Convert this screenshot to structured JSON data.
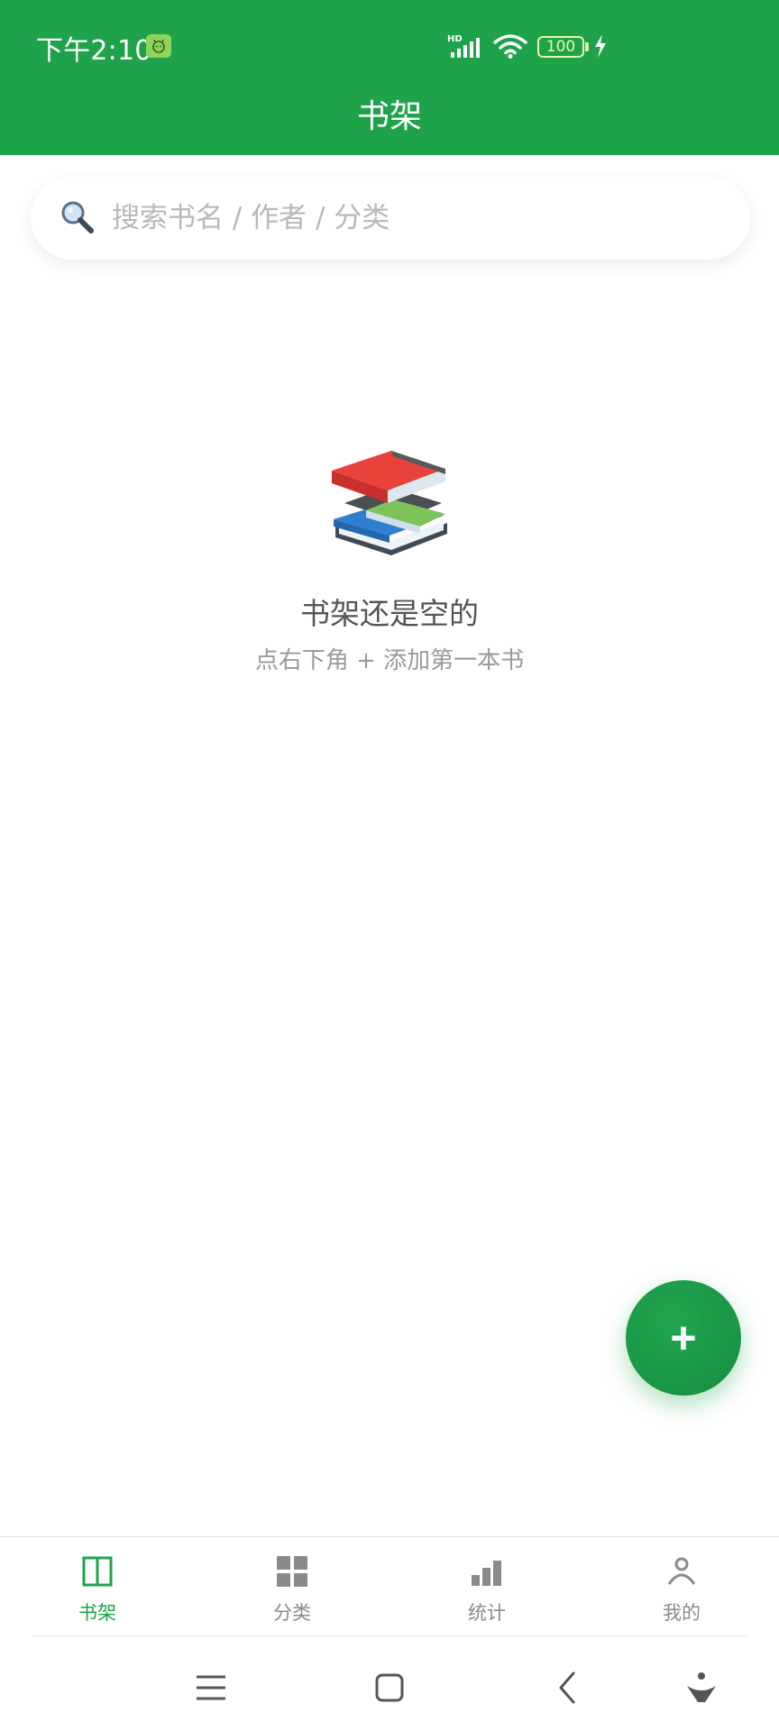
{
  "status_bar": {
    "time": "下午2:10",
    "network_label": "HD",
    "battery_level": "100"
  },
  "header": {
    "title": "书架"
  },
  "search": {
    "placeholder": "搜索书名 / 作者 / 分类"
  },
  "empty_state": {
    "title": "书架还是空的",
    "subtitle": "点右下角 + 添加第一本书"
  },
  "fab": {
    "label": "+"
  },
  "bottom_nav": {
    "items": [
      {
        "label": "书架",
        "icon": "book-icon",
        "active": true
      },
      {
        "label": "分类",
        "icon": "grid-icon",
        "active": false
      },
      {
        "label": "统计",
        "icon": "bar-chart-icon",
        "active": false
      },
      {
        "label": "我的",
        "icon": "person-icon",
        "active": false
      }
    ]
  },
  "system_nav": {
    "icons": [
      "menu-icon",
      "home-icon",
      "back-icon",
      "assistant-icon"
    ]
  },
  "colors": {
    "accent": "#1ea34a",
    "inactive": "#8a8a8a",
    "background": "#ffffff"
  }
}
